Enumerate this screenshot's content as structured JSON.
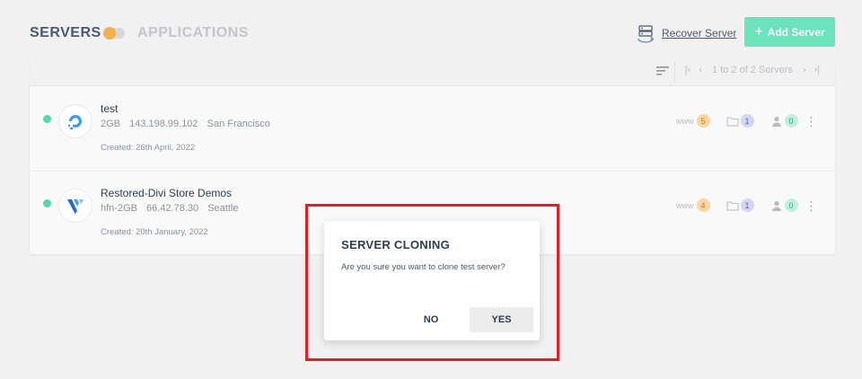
{
  "header": {
    "tab_servers": "SERVERS",
    "tab_applications": "APPLICATIONS",
    "recover_label": "Recover Server",
    "add_label": "Add Server"
  },
  "toolbar": {
    "pager_text": "1 to 2 of 2 Servers",
    "icons": [
      "sort-icon",
      "first-page-icon",
      "prev-page-icon",
      "next-page-icon",
      "last-page-icon"
    ]
  },
  "servers": [
    {
      "name": "test",
      "size": "2GB",
      "ip": "143.198.99.102",
      "location": "San Francisco",
      "created": "Created: 26th April, 2022",
      "www_label": "www",
      "apps": "5",
      "files": "1",
      "users": "0",
      "provider_icon": "digitalocean-logo-icon"
    },
    {
      "name": "Restored-Divi Store Demos",
      "size": "hfn-2GB",
      "ip": "66.42.78.30",
      "location": "Seattle",
      "created": "Created: 20th January, 2022",
      "www_label": "www",
      "apps": "4",
      "files": "1",
      "users": "0",
      "provider_icon": "vultr-logo-icon"
    }
  ],
  "modal": {
    "title": "SERVER CLONING",
    "message": "Are you sure you want to clone test server?",
    "no_label": "NO",
    "yes_label": "YES"
  },
  "colors": {
    "accent_green": "#6de3bd",
    "status_online": "#52d8a9",
    "toggle_knob": "#f3b24f",
    "highlight_border": "#e31e24"
  }
}
